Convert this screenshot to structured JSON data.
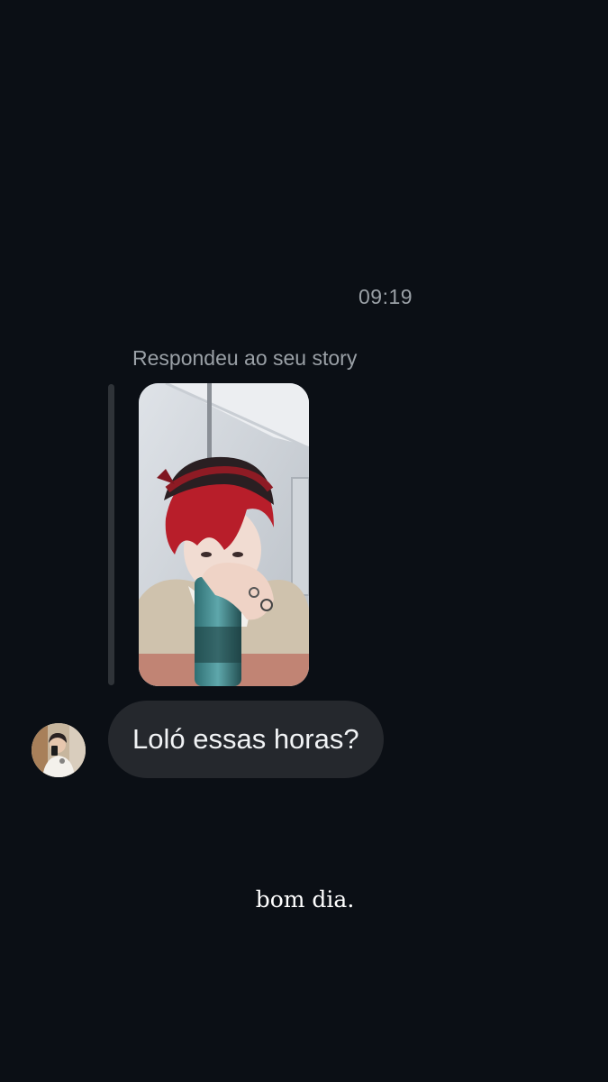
{
  "thread": {
    "timestamp": "09:19",
    "reply_label": "Respondeu ao seu story",
    "message_text": "Loló essas horas?"
  },
  "caption": {
    "text": "bom dia."
  },
  "story": {
    "image": "story-photo"
  },
  "colors": {
    "background": "#0b0f15",
    "bubble": "#25282d",
    "muted_text": "#9aa0a6",
    "quote_bar": "#2f3338"
  }
}
